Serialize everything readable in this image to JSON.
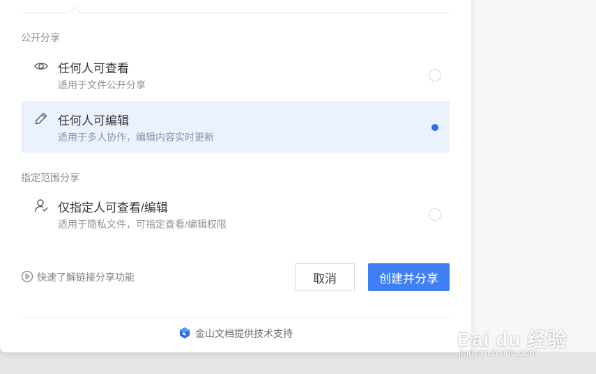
{
  "public_section": {
    "title": "公开分享"
  },
  "options_public": [
    {
      "title": "任何人可查看",
      "desc": "适用于文件公开分享",
      "icon": "eye-icon",
      "selected": false
    },
    {
      "title": "任何人可编辑",
      "desc": "适用于多人协作，编辑内容实时更新",
      "icon": "pencil-icon",
      "selected": true
    }
  ],
  "specified_section": {
    "title": "指定范围分享"
  },
  "options_specified": [
    {
      "title": "仅指定人可查看/编辑",
      "desc": "适用于隐私文件，可指定查看/编辑权限",
      "icon": "user-check-icon",
      "selected": false
    }
  ],
  "help_link": {
    "label": "快速了解链接分享功能",
    "icon": "play-circle-icon"
  },
  "buttons": {
    "cancel": "取消",
    "create": "创建并分享"
  },
  "footer": {
    "label": "金山文档提供技术支持",
    "icon": "kdocs-logo-icon"
  },
  "watermark": {
    "brand": "Bai du 经验",
    "url": "jingyan.baidu.com"
  },
  "colors": {
    "accent": "#3f7ff3",
    "selected_bg": "#ebf2fd",
    "radio_on": "#2b6ff0"
  }
}
